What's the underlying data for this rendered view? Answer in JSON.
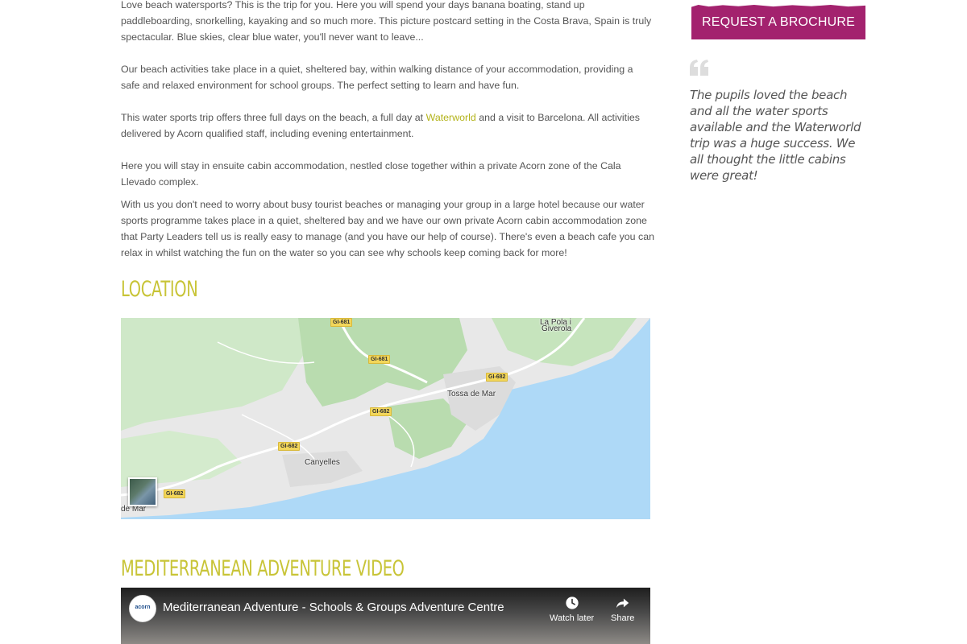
{
  "main": {
    "paragraphs": [
      "Love beach watersports? This is the trip for you. Here you will spend your days banana boating, stand up paddleboarding, snorkelling, kayaking and so much more. This picture postcard setting in the Costa Brava, Spain is truly spectacular. Blue skies, clear blue water, you'll never want to leave...",
      "Our beach activities take place in a quiet, sheltered bay, within walking distance of your accommodation, providing a safe and relaxed environment for school groups. The perfect setting to learn and have fun.",
      "Here you will stay in ensuite cabin accommodation, nestled close together within a private Acorn zone of the Cala Llevado complex.",
      "With us you don't need to worry about busy tourist beaches or managing your group in a large hotel because our water sports programme takes place in a quiet, sheltered bay and we have our own private Acorn cabin accommodation zone that Party Leaders tell us is really easy to manage (and you have our help of course).  There's even a beach cafe you can relax in whilst watching the fun on the water so you can see why schools keep coming back for more!"
    ],
    "waterworld_paragraph": {
      "before": "This water sports trip offers three full days on the beach, a full day at ",
      "link": "Waterworld",
      "after": " and a visit to Barcelona. All activities delivered by Acorn qualified staff, including evening entertainment."
    },
    "location_heading": "Location",
    "video_heading": "Mediterranean Adventure Video"
  },
  "map": {
    "places": [
      "La Pola / Giverola",
      "Tossa de Mar",
      "Canyelles",
      "de Mar"
    ],
    "place_giverola_1": "La Pola i",
    "place_giverola_2": "Giverola",
    "place_tossa": "Tossa de Mar",
    "place_canyelles": "Canyelles",
    "place_lloret": "de Mar",
    "road_1": "GI-681",
    "road_2": "GI-681",
    "road_3": "GI-682",
    "road_4": "GI-682",
    "road_5": "GI-682",
    "road_6": "GI-682"
  },
  "video": {
    "channel_logo": "acorn",
    "title": "Mediterranean Adventure - Schools & Groups Adventure Centre",
    "watch_later": "Watch later",
    "share": "Share"
  },
  "sidebar": {
    "brochure_button": "REQUEST A BROCHURE",
    "testimonial": "The pupils loved the beach and all the water sports available and the Waterworld trip was a huge success. We all thought the little cabins were great!"
  },
  "colors": {
    "accent_heading": "#c8c437",
    "link": "#b3b31a",
    "brochure_bg": "#a3226e",
    "map_water": "#aed9f7",
    "map_land": "#e8e8e8",
    "map_park": "#c8e6c0"
  }
}
